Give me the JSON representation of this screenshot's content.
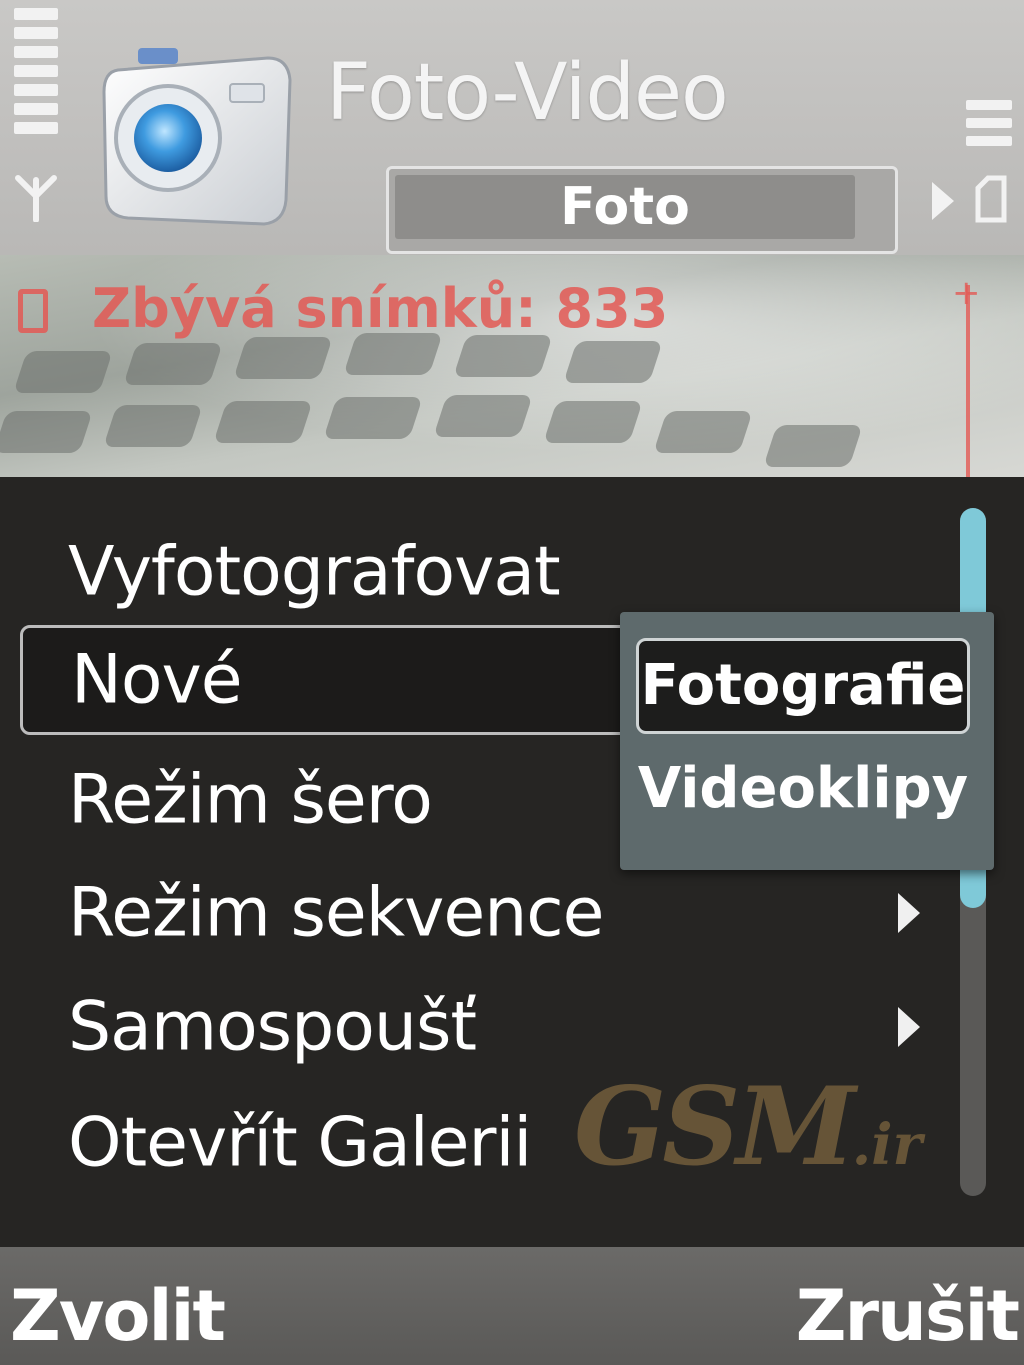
{
  "header": {
    "app_title": "Foto-Video",
    "active_tab": "Foto",
    "icons": {
      "signal": "signal-strength-icon",
      "antenna": "antenna-icon",
      "battery": "battery-level-icon",
      "camera": "camera-app-icon",
      "next_tab": "tab-next-arrow-icon",
      "storage": "memory-storage-icon"
    }
  },
  "viewfinder": {
    "remaining_text": "Zbývá snímků: 833",
    "zoom_icon": "zoom-indicator-icon"
  },
  "menu": {
    "items": [
      {
        "label": "Vyfotografovat",
        "has_submenu": false
      },
      {
        "label": "Nové",
        "has_submenu": true,
        "selected": true
      },
      {
        "label": "Režim šero",
        "has_submenu": false
      },
      {
        "label": "Režim sekvence",
        "has_submenu": true
      },
      {
        "label": "Samospoušť",
        "has_submenu": true
      },
      {
        "label": "Otevřít Galerii",
        "has_submenu": false
      }
    ]
  },
  "submenu": {
    "items": [
      {
        "label": "Fotografie",
        "selected": true
      },
      {
        "label": "Videoklipy"
      }
    ]
  },
  "watermark": {
    "brand": "GSM",
    "suffix": ".ir"
  },
  "softkeys": {
    "left": "Zvolit",
    "right": "Zrušit"
  },
  "colors": {
    "accent": "#7fc9d8",
    "indicator": "#e35a55",
    "menu_background": "#262523"
  }
}
